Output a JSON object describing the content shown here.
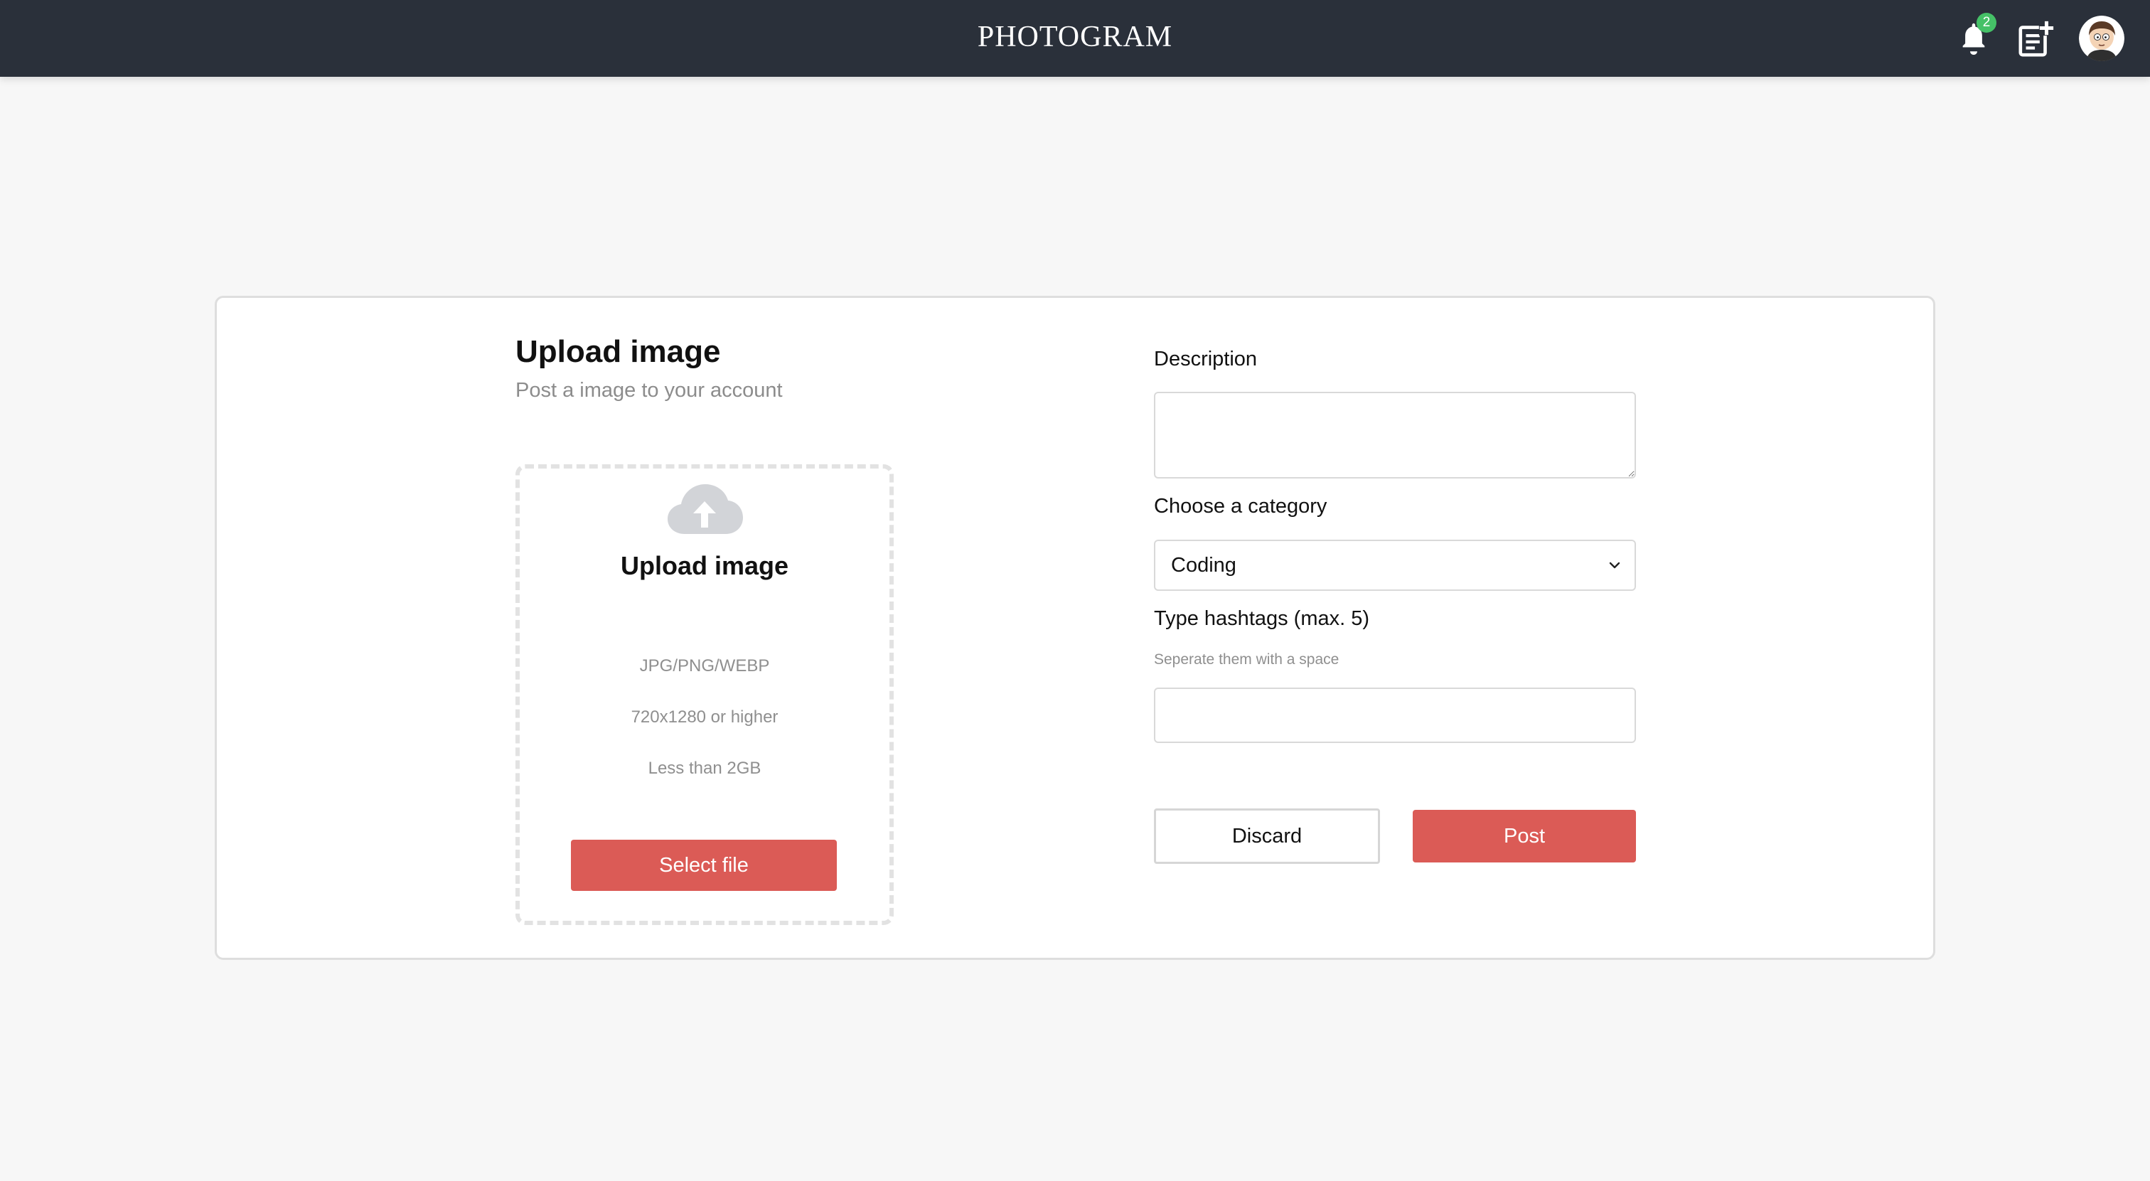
{
  "header": {
    "brand": "PHOTOGRAM",
    "notifications_count": "2",
    "icons": {
      "notifications": "bell-icon",
      "new_post": "add-post-icon",
      "profile": "avatar"
    },
    "colors": {
      "bar": "#2a303a",
      "badge": "#45c167"
    }
  },
  "upload": {
    "title": "Upload image",
    "subtitle": "Post a image to your account",
    "dropzone": {
      "icon": "cloud-upload-icon",
      "title": "Upload image",
      "formats": "JPG/PNG/WEBP",
      "resolution": "720x1280 or higher",
      "size_limit": "Less than 2GB",
      "button_label": "Select file"
    }
  },
  "form": {
    "description_label": "Description",
    "description_value": "",
    "category_label": "Choose a category",
    "category_selected": "Coding",
    "hashtags_label": "Type hashtags (max. 5)",
    "hashtags_hint": "Seperate them with a space",
    "hashtags_value": "",
    "discard_label": "Discard",
    "post_label": "Post"
  },
  "colors": {
    "accent": "#db5b56",
    "page_bg": "#f7f7f7"
  }
}
